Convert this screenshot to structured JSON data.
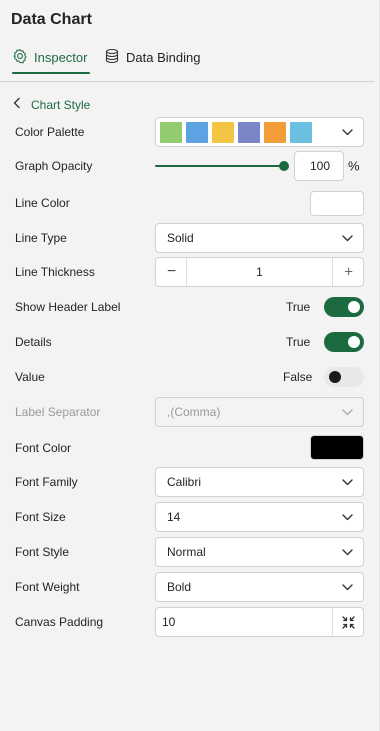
{
  "panel": {
    "title": "Data Chart"
  },
  "tabs": [
    {
      "label": "Inspector",
      "icon": "gear-icon",
      "active": true
    },
    {
      "label": "Data Binding",
      "icon": "database-icon",
      "active": false
    }
  ],
  "section": {
    "label": "Chart Style"
  },
  "properties": {
    "color_palette": {
      "label": "Color Palette",
      "swatches": [
        "#92cc6e",
        "#5da2e2",
        "#f4c542",
        "#7b85c8",
        "#f29d38",
        "#6bbfe0"
      ]
    },
    "graph_opacity": {
      "label": "Graph Opacity",
      "value": "100",
      "unit": "%",
      "fraction": 1.0
    },
    "line_color": {
      "label": "Line Color",
      "color": "#ffffff"
    },
    "line_type": {
      "label": "Line Type",
      "value": "Solid"
    },
    "line_thickness": {
      "label": "Line Thickness",
      "value": "1",
      "minus": "−",
      "plus": "+"
    },
    "show_header_label": {
      "label": "Show Header Label",
      "state_text": "True",
      "on": true
    },
    "details": {
      "label": "Details",
      "state_text": "True",
      "on": true
    },
    "value": {
      "label": "Value",
      "state_text": "False",
      "on": false
    },
    "label_separator": {
      "label": "Label Separator",
      "value": ",(Comma)",
      "disabled": true
    },
    "font_color": {
      "label": "Font Color",
      "color": "#000000"
    },
    "font_family": {
      "label": "Font Family",
      "value": "Calibri"
    },
    "font_size": {
      "label": "Font Size",
      "value": "14"
    },
    "font_style": {
      "label": "Font Style",
      "value": "Normal"
    },
    "font_weight": {
      "label": "Font Weight",
      "value": "Bold"
    },
    "canvas_padding": {
      "label": "Canvas Padding",
      "value": "10"
    }
  },
  "colors": {
    "accent": "#1c6b40",
    "border": "#d1d1d1",
    "background": "#f3f3f3"
  }
}
